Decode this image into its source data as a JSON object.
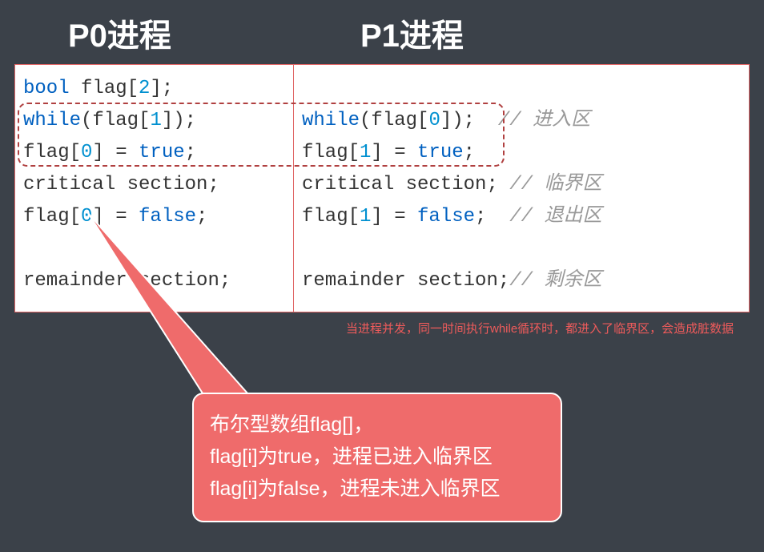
{
  "titles": {
    "p0": "P0进程",
    "p1": "P1进程"
  },
  "code": {
    "p0": {
      "l1_kw": "bool",
      "l1_rest": " flag[",
      "l1_num": "2",
      "l1_end": "];",
      "l2_kw": "while",
      "l2_a": "(flag[",
      "l2_num": "1",
      "l2_b": "]);",
      "l3_a": "flag[",
      "l3_num": "0",
      "l3_b": "] = ",
      "l3_kw": "true",
      "l3_c": ";",
      "l4": "critical section;",
      "l5_a": "flag[",
      "l5_num": "0",
      "l5_b": "] = ",
      "l5_kw": "false",
      "l5_c": ";",
      "l6": "",
      "l7": "remainder section;"
    },
    "p1": {
      "l2_kw": "while",
      "l2_a": "(flag[",
      "l2_num": "0",
      "l2_b": "]);",
      "l2_cmt": "  // 进入区",
      "l3_a": "flag[",
      "l3_num": "1",
      "l3_b": "] = ",
      "l3_kw": "true",
      "l3_c": ";",
      "l4": "critical section;",
      "l4_cmt": " // 临界区",
      "l5_a": "flag[",
      "l5_num": "1",
      "l5_b": "] = ",
      "l5_kw": "false",
      "l5_c": ";",
      "l5_cmt": "  // 退出区",
      "l6": "",
      "l7": "remainder section;",
      "l7_cmt": "// 剩余区"
    }
  },
  "warn": "当进程并发，同一时间执行while循环时，都进入了临界区，会造成脏数据",
  "callout": {
    "l1": "布尔型数组flag[]，",
    "l2": "flag[i]为true，进程已进入临界区",
    "l3": "flag[i]为false，进程未进入临界区"
  }
}
